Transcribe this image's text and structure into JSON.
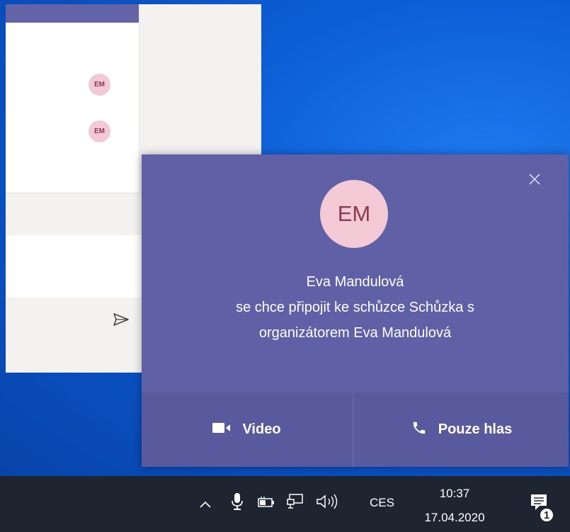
{
  "teams_window": {
    "chat_avatars": [
      {
        "initials": "EM",
        "icon": "avatar"
      },
      {
        "initials": "EM",
        "icon": "avatar"
      }
    ],
    "send_icon": "send-icon"
  },
  "toast": {
    "avatar_initials": "EM",
    "caller_name": "Eva Mandulová",
    "message_line1": "se chce připojit ke schůzce Schůzka s",
    "message_line2": "organizátorem Eva Mandulová",
    "close_icon": "close-icon",
    "video_label": "Video",
    "voice_label": "Pouze hlas",
    "colors": {
      "background": "#5f60a6",
      "button": "#595a9e",
      "avatar_bg": "#f2c9d5",
      "avatar_fg": "#8a3a57"
    }
  },
  "taskbar": {
    "language": "CES",
    "time": "10:37",
    "date": "17.04.2020",
    "notification_count": "1",
    "tray_icons": [
      "chevron-up-icon",
      "microphone-icon",
      "battery-icon",
      "network-icon",
      "speaker-icon",
      "action-center-icon"
    ]
  }
}
